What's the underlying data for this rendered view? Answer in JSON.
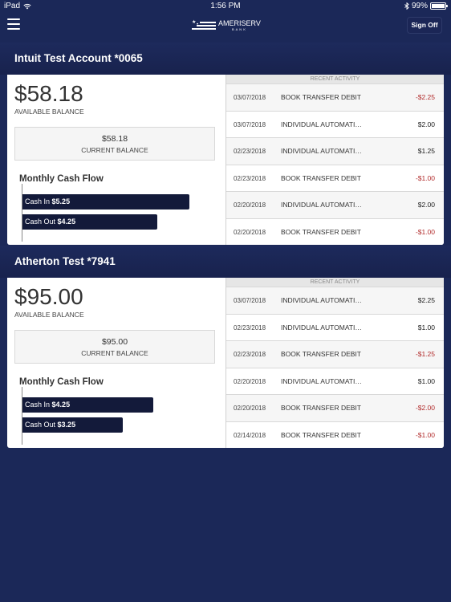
{
  "status_bar": {
    "device": "iPad",
    "time": "1:56 PM",
    "battery_percent": "99%",
    "battery_level": 0.99
  },
  "navbar": {
    "logo_name": "AMERISERV",
    "logo_sub": "BANK",
    "sign_off_label": "Sign Off"
  },
  "accounts": [
    {
      "name": "Intuit Test Account *0065",
      "available_balance": "$58.18",
      "available_label": "AVAILABLE BALANCE",
      "current_balance": "$58.18",
      "current_label": "CURRENT BALANCE",
      "cash_flow_title": "Monthly Cash Flow",
      "cash_in_label": "Cash In",
      "cash_in_value": "$5.25",
      "cash_in_amount": 5.25,
      "cash_out_label": "Cash Out",
      "cash_out_value": "$4.25",
      "cash_out_amount": 4.25,
      "recent_activity_label": "RECENT ACTIVITY",
      "transactions": [
        {
          "date": "03/07/2018",
          "description": "BOOK TRANSFER DEBIT",
          "amount": "-$2.25",
          "negative": true
        },
        {
          "date": "03/07/2018",
          "description": "INDIVIDUAL AUTOMATI…",
          "amount": "$2.00",
          "negative": false
        },
        {
          "date": "02/23/2018",
          "description": "INDIVIDUAL AUTOMATI…",
          "amount": "$1.25",
          "negative": false
        },
        {
          "date": "02/23/2018",
          "description": "BOOK TRANSFER DEBIT",
          "amount": "-$1.00",
          "negative": true
        },
        {
          "date": "02/20/2018",
          "description": "INDIVIDUAL AUTOMATI…",
          "amount": "$2.00",
          "negative": false
        },
        {
          "date": "02/20/2018",
          "description": "BOOK TRANSFER DEBIT",
          "amount": "-$1.00",
          "negative": true
        }
      ]
    },
    {
      "name": "Atherton Test *7941",
      "available_balance": "$95.00",
      "available_label": "AVAILABLE BALANCE",
      "current_balance": "$95.00",
      "current_label": "CURRENT BALANCE",
      "cash_flow_title": "Monthly Cash Flow",
      "cash_in_label": "Cash In",
      "cash_in_value": "$4.25",
      "cash_in_amount": 4.25,
      "cash_out_label": "Cash Out",
      "cash_out_value": "$3.25",
      "cash_out_amount": 3.25,
      "recent_activity_label": "RECENT ACTIVITY",
      "transactions": [
        {
          "date": "03/07/2018",
          "description": "INDIVIDUAL AUTOMATI…",
          "amount": "$2.25",
          "negative": false
        },
        {
          "date": "02/23/2018",
          "description": "INDIVIDUAL AUTOMATI…",
          "amount": "$1.00",
          "negative": false
        },
        {
          "date": "02/23/2018",
          "description": "BOOK TRANSFER DEBIT",
          "amount": "-$1.25",
          "negative": true
        },
        {
          "date": "02/20/2018",
          "description": "INDIVIDUAL AUTOMATI…",
          "amount": "$1.00",
          "negative": false
        },
        {
          "date": "02/20/2018",
          "description": "BOOK TRANSFER DEBIT",
          "amount": "-$2.00",
          "negative": true
        },
        {
          "date": "02/14/2018",
          "description": "BOOK TRANSFER DEBIT",
          "amount": "-$1.00",
          "negative": true
        }
      ]
    }
  ],
  "colors": {
    "background": "#1b2858",
    "bar": "#131a3a",
    "negative": "#b22d2d"
  }
}
